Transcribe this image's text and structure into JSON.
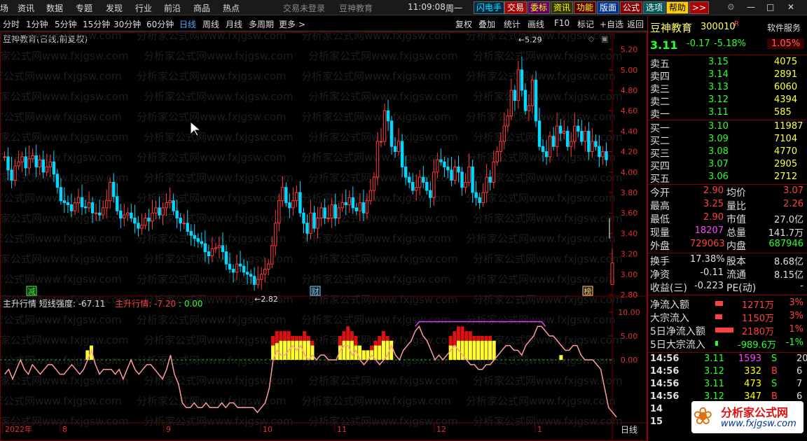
{
  "menu": {
    "items": [
      "场",
      "资讯",
      "数据",
      "专题",
      "发现",
      "行业",
      "前沿",
      "商品",
      "热点"
    ],
    "login": "交易未登录",
    "brand": "豆神教育",
    "time": "11:09:08",
    "weekday": "周一",
    "buttons": [
      {
        "label": "闪电手",
        "color": "#00e6ff",
        "bg": "#002a44"
      },
      {
        "label": "交易",
        "color": "#ffffff",
        "bg": "#b00000"
      },
      {
        "label": "委标",
        "color": "#ffff00",
        "bg": "#660066"
      },
      {
        "label": "资讯",
        "color": "#ffff00",
        "bg": "#333300"
      },
      {
        "label": "功能",
        "color": "#ffff00",
        "bg": "#5a0000"
      },
      {
        "label": "版面",
        "color": "#ffffff",
        "bg": "#003399"
      },
      {
        "label": "公式",
        "color": "#ffffff",
        "bg": "#8a0000"
      },
      {
        "label": "选项",
        "color": "#ffffff",
        "bg": "#005a5a"
      },
      {
        "label": "帮助",
        "color": "#000000",
        "bg": "#ffcc00"
      },
      {
        "label": ">>",
        "color": "#ffffff",
        "bg": "#b00000"
      }
    ]
  },
  "periods": {
    "items": [
      "分时",
      "1分钟",
      "5分钟",
      "15分钟",
      "30分钟",
      "60分钟",
      "日线",
      "周线",
      "月线",
      "多周期",
      "更多 >"
    ],
    "active": "日线",
    "tools": [
      "复权",
      "叠加",
      "统计",
      "画线",
      "F10",
      "标记",
      "+自选",
      "返回"
    ]
  },
  "chart": {
    "title": "豆神教育(日线,前复权)",
    "high_label": "5.29",
    "low_label": "2.82",
    "markers": [
      {
        "text": "减",
        "color": "#2aff2a"
      },
      {
        "text": "财",
        "color": "#66ccff"
      },
      {
        "text": "榜",
        "color": "#ffcc66"
      }
    ]
  },
  "indicator": {
    "name": "主升行情",
    "sub": "短线强度: -67.11",
    "value_label": "主升行情: -7.20",
    "value2": ": 0.00",
    "yticks": [
      "10.00",
      "5.00",
      "0.00"
    ]
  },
  "xaxis": {
    "labels": [
      "2022年",
      "8",
      "9",
      "10",
      "11",
      "12",
      "1"
    ],
    "period_label": "日线"
  },
  "watermark": "分析家公式网www.fxjgsw.com",
  "quote": {
    "name": "豆神教育",
    "code": "300010",
    "flag": "R",
    "service": "软件服务",
    "price": "3.11",
    "change": "-0.17",
    "pct": "-5.18%",
    "turn_badge": "1.05%"
  },
  "orderbook": {
    "asks": [
      {
        "label": "卖五",
        "price": "3.15",
        "vol": "4075"
      },
      {
        "label": "卖四",
        "price": "3.14",
        "vol": "2891"
      },
      {
        "label": "卖三",
        "price": "3.13",
        "vol": "6060"
      },
      {
        "label": "卖二",
        "price": "3.12",
        "vol": "4394"
      },
      {
        "label": "卖一",
        "price": "3.11",
        "vol": "585"
      }
    ],
    "bids": [
      {
        "label": "买一",
        "price": "3.10",
        "vol": "11987"
      },
      {
        "label": "买二",
        "price": "3.09",
        "vol": "7104"
      },
      {
        "label": "买三",
        "price": "3.08",
        "vol": "4770"
      },
      {
        "label": "买四",
        "price": "3.07",
        "vol": "2905"
      },
      {
        "label": "买五",
        "price": "3.06",
        "vol": "2712"
      }
    ]
  },
  "stats": [
    {
      "l1": "今开",
      "v1": "2.90",
      "c1": "#ff4040",
      "l2": "均价",
      "v2": "3.07",
      "c2": "#ff4040"
    },
    {
      "l1": "最高",
      "v1": "3.25",
      "c1": "#ff4040",
      "l2": "量比",
      "v2": "2.26",
      "c2": "#ff4040"
    },
    {
      "l1": "最低",
      "v1": "2.90",
      "c1": "#ff4040",
      "l2": "市值",
      "v2": "27.0亿",
      "c2": "#e0e0e0"
    },
    {
      "l1": "现量",
      "v1": "18207",
      "c1": "#ff40ff",
      "l2": "总量",
      "v2": "141.7万",
      "c2": "#e0e0e0"
    },
    {
      "l1": "外盘",
      "v1": "729063",
      "c1": "#ff4040",
      "l2": "内盘",
      "v2": "687946",
      "c2": "#2aff2a"
    }
  ],
  "stats2": [
    {
      "l1": "换手",
      "v1": "17.38%",
      "c1": "#e0e0e0",
      "l2": "股本",
      "v2": "8.68亿",
      "c2": "#e0e0e0"
    },
    {
      "l1": "净资",
      "v1": "-0.11",
      "c1": "#e0e0e0",
      "l2": "流通",
      "v2": "8.15亿",
      "c2": "#e0e0e0"
    },
    {
      "l1": "收益(三)",
      "v1": "-0.223",
      "c1": "#e0e0e0",
      "l2": "PE(动)",
      "v2": "-",
      "c2": "#e0e0e0"
    }
  ],
  "flows": [
    {
      "label": "净流入额",
      "val": "1271万",
      "pct": "3%",
      "color": "#ff4040",
      "bar": 0.35
    },
    {
      "label": "大宗流入",
      "val": "1150万",
      "pct": "3%",
      "color": "#ff4040",
      "bar": 0.32
    },
    {
      "label": "5日净流入额",
      "val": "2180万",
      "pct": "1%",
      "color": "#ff4040",
      "bar": 0.85
    },
    {
      "label": "5日大宗流入",
      "val": "-989.6万",
      "pct": "-1%",
      "color": "#2aff2a",
      "bar": 0.12
    }
  ],
  "ticks": [
    {
      "t": "14:56",
      "p": "3.11",
      "v": "1593",
      "s": "S",
      "n": "20",
      "vc": "#ff40ff"
    },
    {
      "t": "14:56",
      "p": "3.12",
      "v": "332",
      "s": "B",
      "n": "6",
      "vc": "#ffff00"
    },
    {
      "t": "14:56",
      "p": "3.11",
      "v": "473",
      "s": "S",
      "n": "7",
      "vc": "#ffff00"
    },
    {
      "t": "14:56",
      "p": "3.12",
      "v": "347",
      "s": "B",
      "n": "6",
      "vc": "#ffff00"
    },
    {
      "t": "14",
      "p": "",
      "v": "",
      "s": "",
      "n": "",
      "vc": "#ffff00"
    },
    {
      "t": "15",
      "p": "",
      "v": "",
      "s": "",
      "n": "",
      "vc": "#ffff00"
    }
  ],
  "logo": {
    "name": "分析家公式网",
    "url": "www.fxjgsw.com"
  },
  "chart_data": {
    "type": "candlestick",
    "ylim": [
      2.8,
      5.3
    ],
    "yticks": [
      5.2,
      5.0,
      4.8,
      4.6,
      4.4,
      4.2,
      4.0,
      3.8,
      3.6,
      3.4,
      3.2,
      3.0,
      2.8
    ],
    "close": [
      4.15,
      4.02,
      3.92,
      4.06,
      4.1,
      4.15,
      4.04,
      4.13,
      4.16,
      4.05,
      4.12,
      4.0,
      4.05,
      4.1,
      3.98,
      3.85,
      3.72,
      3.7,
      3.68,
      3.62,
      3.7,
      3.75,
      3.66,
      3.65,
      3.7,
      3.6,
      3.6,
      3.58,
      3.65,
      3.72,
      3.9,
      3.76,
      3.62,
      3.55,
      3.58,
      3.6,
      3.55,
      3.5,
      3.45,
      3.48,
      3.55,
      3.52,
      3.6,
      3.65,
      3.58,
      3.65,
      3.7,
      3.72,
      3.62,
      3.55,
      3.5,
      3.5,
      3.42,
      3.38,
      3.35,
      3.32,
      3.3,
      3.22,
      3.18,
      3.25,
      3.26,
      3.28,
      3.22,
      3.1,
      3.05,
      3.02,
      3.1,
      3.08,
      3.02,
      3.0,
      2.98,
      2.9,
      2.95,
      3.0,
      3.05,
      3.1,
      3.28,
      3.5,
      3.72,
      3.85,
      3.7,
      3.65,
      3.72,
      3.8,
      3.6,
      3.5,
      3.4,
      3.6,
      3.45,
      3.55,
      3.65,
      3.55,
      3.55,
      3.68,
      3.55,
      3.65,
      3.7,
      3.68,
      3.75,
      3.65,
      3.62,
      3.7,
      3.6,
      3.72,
      3.82,
      3.95,
      4.3,
      4.3,
      4.6,
      4.5,
      4.25,
      4.2,
      4.3,
      4.05,
      3.95,
      3.9,
      3.82,
      3.85,
      3.95,
      3.9,
      3.82,
      3.75,
      4.0,
      4.12,
      4.1,
      4.05,
      4.02,
      3.92,
      4.05,
      4.0,
      3.85,
      3.9,
      4.05,
      3.8,
      3.75,
      3.7,
      3.8,
      3.95,
      3.9,
      4.1,
      4.2,
      4.3,
      4.45,
      4.55,
      4.8,
      4.7,
      5.0,
      4.8,
      4.6,
      4.65,
      4.9,
      4.5,
      4.25,
      4.2,
      4.15,
      4.35,
      4.25,
      4.45,
      4.38,
      4.4,
      4.25,
      4.3,
      4.45,
      4.4,
      4.3,
      4.4,
      4.2,
      4.3,
      4.25,
      4.15,
      4.2,
      4.12
    ]
  },
  "indicator_data": {
    "ylim": [
      -12,
      11
    ],
    "line": [
      -3,
      -2,
      -4,
      -2,
      0,
      -2,
      -3,
      -1,
      -2,
      -3,
      -2,
      -1,
      -1,
      -2,
      -3,
      -3,
      -2,
      -1,
      -2,
      -3,
      -2,
      0,
      2,
      -1,
      -3,
      -2,
      -2,
      -2,
      -3,
      -2,
      -4,
      -2,
      0,
      -2,
      -3,
      -2,
      -1,
      -1,
      -2,
      -3,
      -4,
      -2,
      1,
      -3,
      -5,
      -9,
      -10,
      -10,
      -9,
      -10,
      -10,
      -9,
      -10,
      -10,
      -10,
      -9,
      -10,
      -9,
      -9,
      -10,
      -10,
      -10,
      -10,
      -10,
      -11,
      -10,
      -9,
      -6,
      0,
      2,
      1,
      1,
      2,
      3,
      2,
      3,
      1,
      0,
      1,
      0,
      1,
      1,
      0,
      0,
      0,
      2,
      3,
      3,
      1,
      2,
      0,
      -1,
      0,
      1,
      0,
      -1,
      0,
      1,
      3,
      1,
      0,
      2,
      3,
      4,
      6,
      7,
      5,
      4,
      2,
      0,
      1,
      0,
      1,
      2,
      3,
      2,
      1,
      0,
      -1,
      -1,
      -2,
      -2,
      -1,
      -1,
      0,
      1,
      2,
      3,
      3,
      2,
      2,
      1,
      3,
      4,
      5,
      7,
      7,
      6,
      5,
      5,
      4,
      3,
      2,
      2,
      3,
      3,
      1,
      0,
      0,
      0,
      -1,
      -2,
      -6,
      -10,
      -11,
      -12
    ],
    "yellow": [
      0,
      0,
      0,
      0,
      0,
      0,
      0,
      0,
      0,
      0,
      0,
      0,
      0,
      0,
      0,
      0,
      0,
      0,
      0,
      0,
      0,
      2,
      3,
      0,
      0,
      0,
      0,
      0,
      0,
      0,
      0,
      0,
      0,
      0,
      0,
      0,
      0,
      0,
      0,
      0,
      0,
      0,
      0,
      0,
      0,
      0,
      0,
      0,
      0,
      0,
      0,
      0,
      0,
      0,
      0,
      0,
      0,
      0,
      0,
      0,
      0,
      0,
      0,
      0,
      0,
      0,
      0,
      0,
      3,
      3.5,
      4,
      4,
      4,
      4,
      4,
      4,
      4,
      4,
      3,
      0,
      0,
      0,
      0,
      0,
      0,
      3,
      4,
      4,
      4,
      3,
      3,
      2,
      2,
      2,
      3,
      3,
      4,
      4,
      4,
      0,
      0,
      0,
      0,
      0,
      0,
      0,
      0,
      0,
      0,
      0,
      0,
      0,
      0,
      3,
      3,
      4,
      4,
      4,
      4,
      4,
      4,
      4,
      4,
      4,
      4,
      0,
      0,
      0,
      0,
      0,
      0,
      0,
      0,
      0,
      0,
      0,
      0,
      0,
      0,
      0,
      0,
      1,
      0,
      0,
      0
    ],
    "red": [
      0,
      0,
      0,
      0,
      0,
      0,
      0,
      0,
      0,
      0,
      0,
      0,
      0,
      0,
      0,
      0,
      0,
      0,
      0,
      0,
      0,
      0,
      0,
      0,
      0,
      0,
      0,
      0,
      0,
      0,
      0,
      0,
      0,
      0,
      0,
      0,
      0,
      0,
      0,
      0,
      0,
      0,
      0,
      0,
      0,
      0,
      0,
      0,
      0,
      0,
      0,
      0,
      0,
      0,
      0,
      0,
      0,
      0,
      0,
      0,
      0,
      0,
      0,
      0,
      0,
      0,
      0,
      0,
      5,
      6,
      6,
      6,
      6,
      5,
      5,
      5,
      6,
      5,
      4,
      0,
      0,
      0,
      0,
      0,
      0,
      5,
      6,
      7,
      6,
      5,
      3,
      2,
      2,
      3,
      4,
      5,
      6,
      5,
      4,
      0,
      0,
      0,
      0,
      0,
      0,
      0,
      0,
      0,
      0,
      0,
      0,
      0,
      0,
      5,
      6,
      7,
      7,
      6,
      6,
      5,
      5,
      5,
      5,
      5,
      4,
      0,
      0,
      0,
      0,
      0,
      0,
      0,
      0,
      0,
      0,
      0,
      0,
      0,
      0,
      0,
      0,
      0,
      0,
      0,
      0
    ]
  }
}
